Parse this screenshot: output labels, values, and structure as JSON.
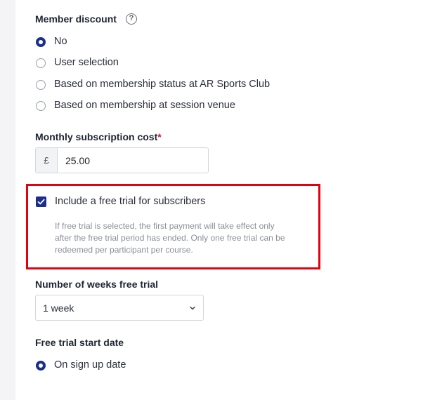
{
  "member_discount": {
    "label": "Member discount",
    "help_symbol": "?",
    "options": [
      {
        "label": "No",
        "selected": true
      },
      {
        "label": "User selection",
        "selected": false
      },
      {
        "label": "Based on membership status at AR Sports Club",
        "selected": false
      },
      {
        "label": "Based on membership at session venue",
        "selected": false
      }
    ]
  },
  "subscription_cost": {
    "label": "Monthly subscription cost",
    "required_mark": "*",
    "currency": "£",
    "value": "25.00"
  },
  "free_trial": {
    "checkbox_label": "Include a free trial for subscribers",
    "checked": true,
    "note_lines": [
      "If free trial is selected, the first payment will take effect only",
      "after the free trial period has ended. Only one free trial can be",
      "redeemed per participant per course."
    ]
  },
  "weeks_free_trial": {
    "label": "Number of weeks free trial",
    "selected": "1 week"
  },
  "trial_start": {
    "label": "Free trial start date",
    "options": [
      {
        "label": "On sign up date",
        "selected": true
      }
    ]
  },
  "colors": {
    "accent": "#1b2f8a",
    "highlight": "#e3000f",
    "required": "#d6152b"
  },
  "icons": {
    "help": "question-circle-icon",
    "chevron": "chevron-down-icon",
    "check": "checkmark-icon"
  }
}
